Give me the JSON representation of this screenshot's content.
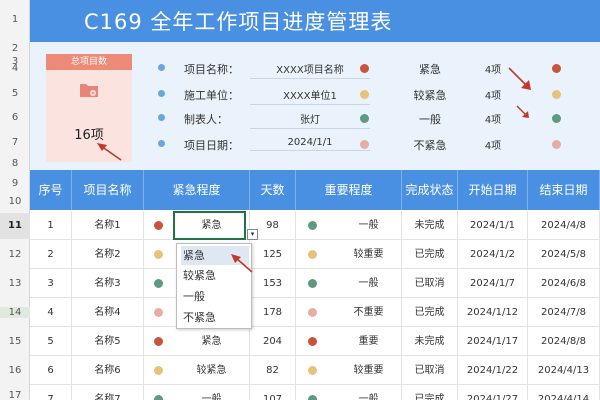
{
  "title": "C169 全年工作项目进度管理表",
  "row_numbers": [
    "1",
    "2",
    "3",
    "4",
    "5",
    "6",
    "7",
    "8",
    "9",
    "10",
    "11",
    "12",
    "13",
    "14",
    "15",
    "16",
    "17"
  ],
  "summary_card": {
    "header": "总项目数",
    "value": "16项",
    "icon": "folder-icon"
  },
  "info": [
    {
      "label": "项目名称：",
      "value": "XXXX项目名称"
    },
    {
      "label": "施工单位：",
      "value": "XXXX单位1"
    },
    {
      "label": "制表人：",
      "value": "张灯"
    },
    {
      "label": "项目日期：",
      "value": "2024/1/1"
    }
  ],
  "priority_summary": [
    {
      "label": "紧急",
      "count": "4项",
      "color": "#c9533c"
    },
    {
      "label": "较紧急",
      "count": "4项",
      "color": "#e8c27a"
    },
    {
      "label": "一般",
      "count": "4项",
      "color": "#5e9a7e"
    },
    {
      "label": "不紧急",
      "count": "4项",
      "color": "#e6ada4"
    }
  ],
  "table": {
    "headers": [
      "序号",
      "项目名称",
      "紧急程度",
      "天数",
      "重要程度",
      "完成状态",
      "开始日期",
      "结束日期"
    ],
    "rows": [
      {
        "no": "1",
        "name": "名称1",
        "urgency": "紧急",
        "ucolor": "#c9533c",
        "days": "98",
        "importance": "一般",
        "icolor": "#5e9a7e",
        "status": "未完成",
        "start": "2024/1/1",
        "end": "2024/4/8"
      },
      {
        "no": "2",
        "name": "名称2",
        "urgency": "",
        "ucolor": "#e8c27a",
        "days": "125",
        "importance": "较重要",
        "icolor": "#e8c27a",
        "status": "已完成",
        "start": "2024/1/2",
        "end": "2024/5/8"
      },
      {
        "no": "3",
        "name": "名称3",
        "urgency": "",
        "ucolor": "#5e9a7e",
        "days": "153",
        "importance": "一般",
        "icolor": "#5e9a7e",
        "status": "已取消",
        "start": "2024/1/7",
        "end": "2024/6/8"
      },
      {
        "no": "4",
        "name": "名称4",
        "urgency": "",
        "ucolor": "#e6ada4",
        "days": "178",
        "importance": "不重要",
        "icolor": "#e6ada4",
        "status": "已完成",
        "start": "2024/1/12",
        "end": "2024/7/8"
      },
      {
        "no": "5",
        "name": "名称5",
        "urgency": "紧急",
        "ucolor": "#c9533c",
        "days": "204",
        "importance": "重要",
        "icolor": "#c9533c",
        "status": "未完成",
        "start": "2024/1/17",
        "end": "2024/8/8"
      },
      {
        "no": "6",
        "name": "名称6",
        "urgency": "较紧急",
        "ucolor": "#e8c27a",
        "days": "82",
        "importance": "较重要",
        "icolor": "#e8c27a",
        "status": "已取消",
        "start": "2024/1/22",
        "end": "2024/4/13"
      },
      {
        "no": "7",
        "name": "名称7",
        "urgency": "一般",
        "ucolor": "#5e9a7e",
        "days": "107",
        "importance": "一般",
        "icolor": "#5e9a7e",
        "status": "已完成",
        "start": "2024/1/27",
        "end": "2024/4/14"
      }
    ]
  },
  "dropdown_options": [
    "紧急",
    "较紧急",
    "一般",
    "不紧急"
  ],
  "dropdown_button": "▾"
}
